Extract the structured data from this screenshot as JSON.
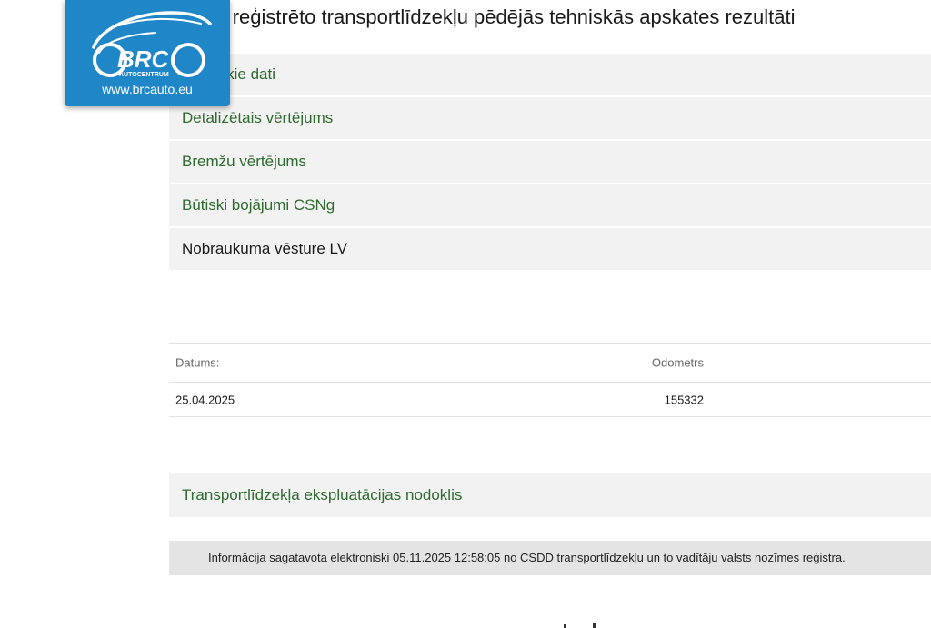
{
  "page": {
    "title": "Latvijā reģistrēto transportlīdzekļu pēdējās tehniskās apskates rezultāti"
  },
  "menu": {
    "items": [
      {
        "label": "Tehniskie dati"
      },
      {
        "label": "Detalizētais vērtējums"
      },
      {
        "label": "Bremžu vērtējums"
      },
      {
        "label": "Būtiski bojājumi CSNg"
      },
      {
        "label": "Nobraukuma vēsture LV"
      }
    ]
  },
  "odometer_table": {
    "headers": {
      "date": "Datums:",
      "odometer": "Odometrs"
    },
    "rows": [
      {
        "date": "25.04.2025",
        "odometer": "155332"
      }
    ]
  },
  "tax_section": {
    "label": "Transportlīdzekļa ekspluatācijas nodoklis"
  },
  "info_bar": {
    "text": "Informācija sagatavota elektroniski 05.11.2025 12:58:05 no CSDD transportlīdzekļu un to vadītāju valsts nozīmes reģistra."
  },
  "logo": {
    "brand": "BRC",
    "sub": "AUTOCENTRUM",
    "url": "www.brcauto.eu",
    "icon": "car-outline-icon"
  },
  "colors": {
    "link_green": "#2e6b2e",
    "menu_bg": "#f2f2f2",
    "info_bg": "#e4e4e4",
    "logo_blue": "#1f86c8"
  }
}
